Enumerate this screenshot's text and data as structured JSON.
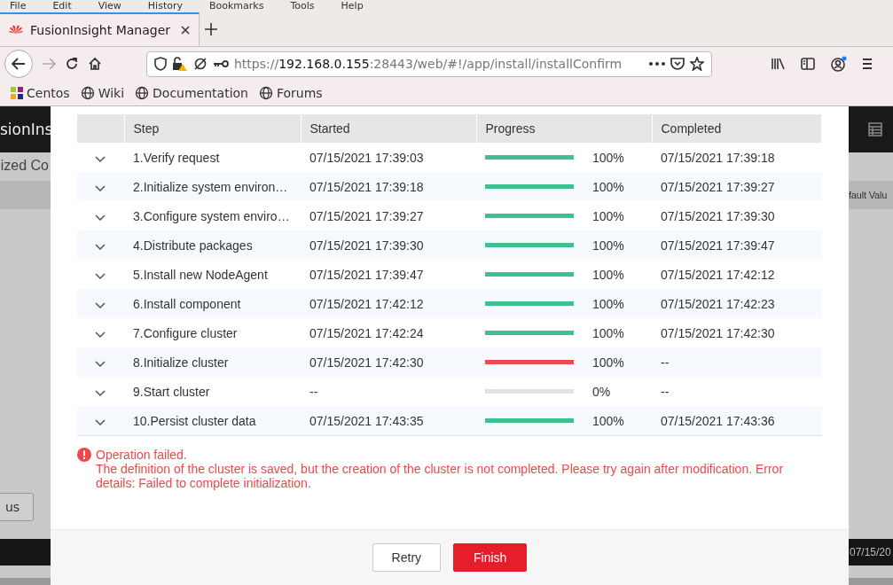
{
  "menu_bar": [
    "File",
    "Edit",
    "View",
    "History",
    "Bookmarks",
    "Tools",
    "Help"
  ],
  "tab": {
    "title": "FusionInsight Manager",
    "selected": true
  },
  "address_bar": {
    "scheme": "https://",
    "host": "192.168.0.155",
    "rest": ":28443/web/#!/app/install/installConfirm"
  },
  "bookmarks": [
    "Centos",
    "Wiki",
    "Documentation",
    "Forums"
  ],
  "background": {
    "header_title": "sionIns",
    "page_title": "ized Co",
    "column_header": "fault Valu",
    "button": "us",
    "footer_time": "07/15/20"
  },
  "dialog": {
    "columns": [
      "Step",
      "Started",
      "Progress",
      "Completed"
    ],
    "rows": [
      {
        "step": "1.Verify request",
        "started": "07/15/2021 17:39:03",
        "level": 1,
        "color": "#3cc18f",
        "percent": "100%",
        "completed": "07/15/2021 17:39:18"
      },
      {
        "step": "2.Initialize system environ…",
        "started": "07/15/2021 17:39:18",
        "level": 1,
        "color": "#3cc18f",
        "percent": "100%",
        "completed": "07/15/2021 17:39:27"
      },
      {
        "step": "3.Configure system enviro…",
        "started": "07/15/2021 17:39:27",
        "level": 1,
        "color": "#3cc18f",
        "percent": "100%",
        "completed": "07/15/2021 17:39:30"
      },
      {
        "step": "4.Distribute packages",
        "started": "07/15/2021 17:39:30",
        "level": 1,
        "color": "#3cc18f",
        "percent": "100%",
        "completed": "07/15/2021 17:39:47"
      },
      {
        "step": "5.Install new NodeAgent",
        "started": "07/15/2021 17:39:47",
        "level": 1,
        "color": "#3cc18f",
        "percent": "100%",
        "completed": "07/15/2021 17:42:12"
      },
      {
        "step": "6.Install component",
        "started": "07/15/2021 17:42:12",
        "level": 1,
        "color": "#3cc18f",
        "percent": "100%",
        "completed": "07/15/2021 17:42:23"
      },
      {
        "step": "7.Configure cluster",
        "started": "07/15/2021 17:42:24",
        "level": 1,
        "color": "#3cc18f",
        "percent": "100%",
        "completed": "07/15/2021 17:42:30"
      },
      {
        "step": "8.Initialize cluster",
        "started": "07/15/2021 17:42:30",
        "level": 1,
        "color": "#f04a4a",
        "percent": "100%",
        "completed": "--"
      },
      {
        "step": "9.Start cluster",
        "started": "--",
        "level": 0,
        "percent": "0%",
        "completed": "--"
      },
      {
        "step": "10.Persist cluster data",
        "started": "07/15/2021 17:43:35",
        "level": 1,
        "color": "#3cc18f",
        "percent": "100%",
        "completed": "07/15/2021 17:43:36"
      }
    ],
    "error_title": "Operation failed.",
    "error_message": "The definition of the cluster is saved, but the creation of the cluster is not completed. Please try again after modification. Error details: Failed to complete initialization.",
    "buttons": [
      "Retry",
      "Finish"
    ]
  }
}
